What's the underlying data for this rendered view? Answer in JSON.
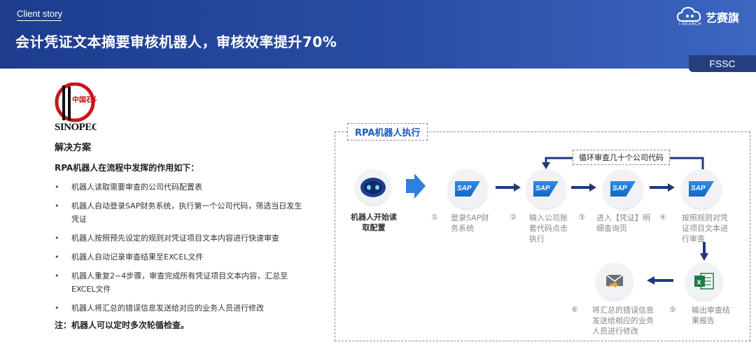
{
  "header": {
    "client_story": "Client story",
    "title": "会计凭证文本摘要审核机器人，审核效率提升70%",
    "logo_text": "艺赛旗",
    "logo_sub": "i-SEARCH",
    "tag": "FSSC"
  },
  "company_logo": {
    "text": "SINOPEC",
    "chinese": "中国石化"
  },
  "solution": {
    "title": "解决方案",
    "subtitle": "RPA机器人在流程中发挥的作用如下：",
    "bullets": [
      "机器人读取需要审查的公司代码配置表",
      "机器人自动登录SAP财务系统，执行第一个公司代码，筛选当日发生凭证",
      "机器人按照预先设定的规则对凭证项目文本内容进行快速审查",
      "机器人自动记录审查结果至EXCEL文件",
      "机器人重复2~4步骤，审查完成所有凭证项目文本内容，汇总至EXCEL文件",
      "机器人将汇总的错误信息发送给对应的业务人员进行修改"
    ],
    "note": "注：机器人可以定时多次轮循检查。"
  },
  "flow": {
    "title": "RPA机器人执行",
    "loop_label": "循环审查几十个公司代码",
    "robot_label_1": "机器人开始读",
    "robot_label_2": "取配置",
    "steps": [
      {
        "num": "①",
        "lines": [
          "登录SAP财",
          "务系统"
        ]
      },
      {
        "num": "②",
        "lines": [
          "输入公司账",
          "套代码点击",
          "执行"
        ]
      },
      {
        "num": "③",
        "lines": [
          "进入【凭证】明",
          "细查询页"
        ]
      },
      {
        "num": "④",
        "lines": [
          "按照规则对凭",
          "证项目文本进",
          "行审查"
        ]
      },
      {
        "num": "⑤",
        "lines": [
          "输出审查结",
          "果报告"
        ]
      },
      {
        "num": "⑥",
        "lines": [
          "将汇总的错误信息",
          "发送给相应的业务",
          "人员进行修改"
        ]
      }
    ],
    "sap_text": "SAP",
    "colors": {
      "arrow": "#1e3a78",
      "accent": "#1a58c4",
      "excel": "#1f7a45",
      "mail": "#f0a030"
    }
  }
}
